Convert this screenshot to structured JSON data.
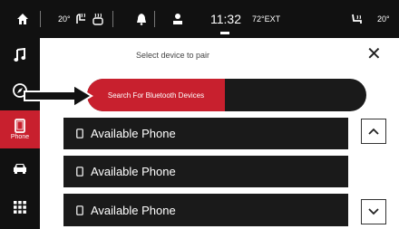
{
  "status": {
    "outside_temp_left": "20°",
    "clock": "11:32",
    "outside_temp_ext": "72°EXT",
    "outside_temp_right": "20°"
  },
  "sidebar": {
    "items": [
      {
        "icon": "home-icon"
      },
      {
        "icon": "music-note-icon"
      },
      {
        "icon": "compass-icon"
      },
      {
        "icon": "phone-icon",
        "label": "Phone"
      },
      {
        "icon": "car-icon"
      },
      {
        "icon": "apps-grid-icon"
      }
    ]
  },
  "dialog": {
    "title": "Select device to pair",
    "close": "✕",
    "search_button": "Search For Bluetooth Devices",
    "devices": [
      {
        "label": "Available Phone"
      },
      {
        "label": "Available Phone"
      },
      {
        "label": "Available Phone"
      }
    ]
  },
  "colors": {
    "accent": "#c8202e",
    "panel": "#1a1a1a",
    "bar": "#111111"
  }
}
